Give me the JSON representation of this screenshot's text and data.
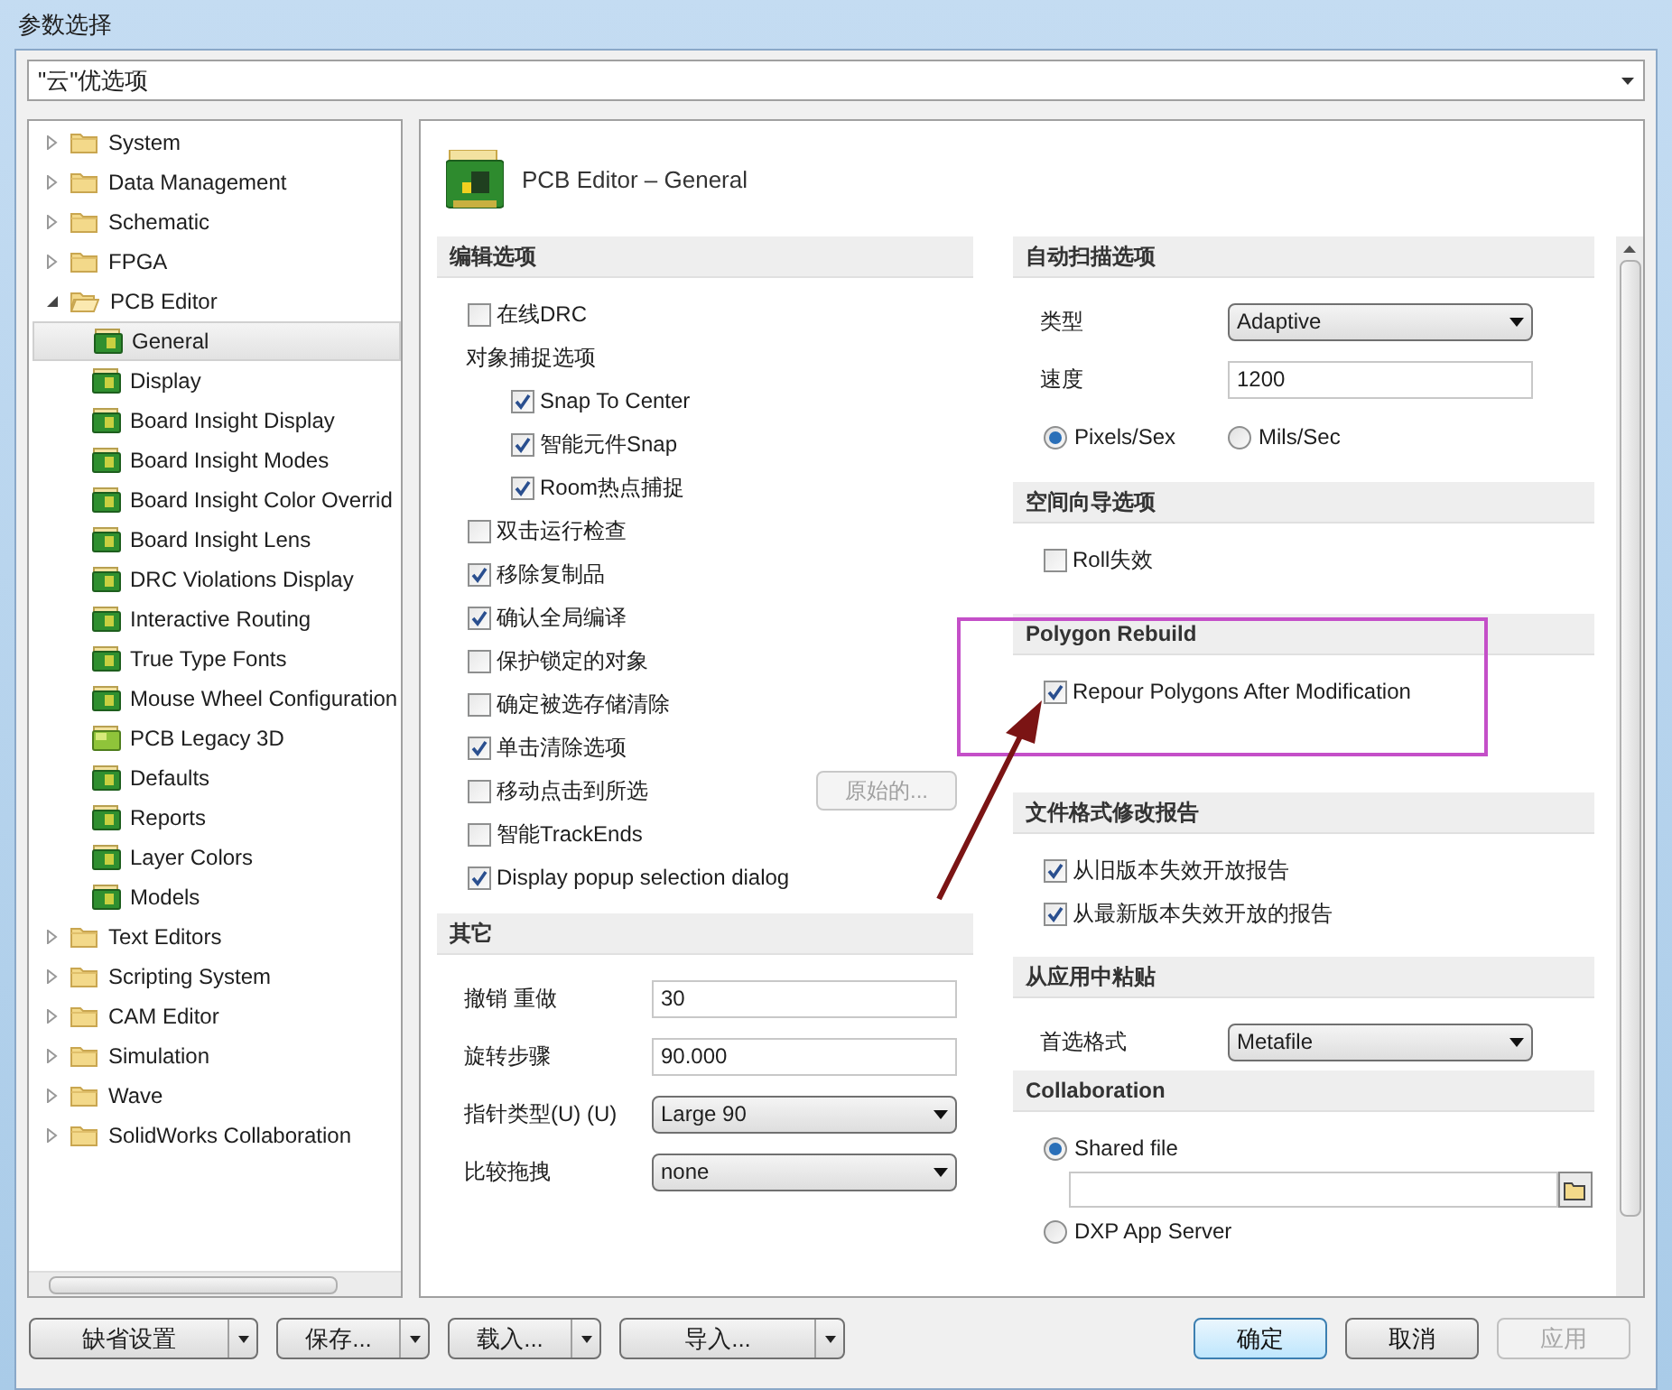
{
  "window": {
    "title": "参数选择"
  },
  "preset_combo": {
    "value": "\"云\"优选项"
  },
  "tree": [
    {
      "kind": "folder",
      "label": "System",
      "expanded": false
    },
    {
      "kind": "folder",
      "label": "Data Management",
      "expanded": false
    },
    {
      "kind": "folder",
      "label": "Schematic",
      "expanded": false
    },
    {
      "kind": "folder",
      "label": "FPGA",
      "expanded": false
    },
    {
      "kind": "folder",
      "label": "PCB Editor",
      "expanded": true,
      "children": [
        {
          "kind": "page",
          "label": "General",
          "selected": true
        },
        {
          "kind": "page",
          "label": "Display",
          "selected": false
        },
        {
          "kind": "page",
          "label": "Board Insight Display",
          "selected": false
        },
        {
          "kind": "page",
          "label": "Board Insight Modes",
          "selected": false
        },
        {
          "kind": "page",
          "label": "Board Insight Color Overrid",
          "selected": false
        },
        {
          "kind": "page",
          "label": "Board Insight Lens",
          "selected": false
        },
        {
          "kind": "page",
          "label": "DRC Violations Display",
          "selected": false
        },
        {
          "kind": "page",
          "label": "Interactive Routing",
          "selected": false
        },
        {
          "kind": "page",
          "label": "True Type Fonts",
          "selected": false
        },
        {
          "kind": "page",
          "label": "Mouse Wheel Configuration",
          "selected": false
        },
        {
          "kind": "page3d",
          "label": "PCB Legacy 3D",
          "selected": false
        },
        {
          "kind": "page",
          "label": "Defaults",
          "selected": false
        },
        {
          "kind": "page",
          "label": "Reports",
          "selected": false
        },
        {
          "kind": "page",
          "label": "Layer Colors",
          "selected": false
        },
        {
          "kind": "page",
          "label": "Models",
          "selected": false
        }
      ]
    },
    {
      "kind": "folder",
      "label": "Text Editors",
      "expanded": false
    },
    {
      "kind": "folder",
      "label": "Scripting System",
      "expanded": false
    },
    {
      "kind": "folder",
      "label": "CAM Editor",
      "expanded": false
    },
    {
      "kind": "folder",
      "label": "Simulation",
      "expanded": false
    },
    {
      "kind": "folder",
      "label": "Wave",
      "expanded": false
    },
    {
      "kind": "folder",
      "label": "SolidWorks Collaboration",
      "expanded": false
    }
  ],
  "page_title": "PCB Editor – General",
  "left_column": [
    {
      "heading": "编辑选项",
      "items": [
        {
          "kind": "checkbox",
          "label": "在线DRC",
          "checked": false
        },
        {
          "kind": "group",
          "label": "对象捕捉选项",
          "children": [
            {
              "kind": "checkbox",
              "label": "Snap To Center",
              "checked": true
            },
            {
              "kind": "checkbox",
              "label": "智能元件Snap",
              "checked": true
            },
            {
              "kind": "checkbox",
              "label": "Room热点捕捉",
              "checked": true
            }
          ]
        },
        {
          "kind": "checkbox",
          "label": "双击运行检查",
          "checked": false
        },
        {
          "kind": "checkbox",
          "label": "移除复制品",
          "checked": true
        },
        {
          "kind": "checkbox",
          "label": "确认全局编译",
          "checked": true
        },
        {
          "kind": "checkbox",
          "label": "保护锁定的对象",
          "checked": false
        },
        {
          "kind": "checkbox",
          "label": "确定被选存储清除",
          "checked": false
        },
        {
          "kind": "checkbox",
          "label": "单击清除选项",
          "checked": true
        },
        {
          "kind": "checkbox",
          "label": "移动点击到所选",
          "checked": false,
          "button": {
            "label": "原始的...",
            "disabled": true
          }
        },
        {
          "kind": "checkbox",
          "label": "智能TrackEnds",
          "checked": false
        },
        {
          "kind": "checkbox",
          "label": "Display popup selection dialog",
          "checked": true
        }
      ]
    },
    {
      "heading": "其它",
      "items": [
        {
          "kind": "text",
          "label": "撤销 重做",
          "value": "30"
        },
        {
          "kind": "text",
          "label": "旋转步骤",
          "value": "90.000"
        },
        {
          "kind": "select",
          "label": "指针类型(U) (U)",
          "value": "Large 90"
        },
        {
          "kind": "select",
          "label": "比较拖拽",
          "value": "none"
        }
      ]
    }
  ],
  "right_column": [
    {
      "heading": "自动扫描选项",
      "items": [
        {
          "kind": "select",
          "label": "类型",
          "value": "Adaptive"
        },
        {
          "kind": "text",
          "label": "速度",
          "value": "1200"
        },
        {
          "kind": "radios",
          "options": [
            {
              "label": "Pixels/Sex",
              "selected": true
            },
            {
              "label": "Mils/Sec",
              "selected": false
            }
          ]
        }
      ]
    },
    {
      "heading": "空间向导选项",
      "items": [
        {
          "kind": "checkbox",
          "label": "Roll失效",
          "checked": false
        }
      ]
    },
    {
      "heading": "Polygon Rebuild",
      "items": [
        {
          "kind": "checkbox",
          "label": "Repour Polygons After Modification",
          "checked": true
        }
      ]
    },
    {
      "heading": "文件格式修改报告",
      "items": [
        {
          "kind": "checkbox",
          "label": "从旧版本失效开放报告",
          "checked": true
        },
        {
          "kind": "checkbox",
          "label": "从最新版本失效开放的报告",
          "checked": true
        }
      ]
    },
    {
      "heading": "从应用中粘贴",
      "items": [
        {
          "kind": "select",
          "label": "首选格式",
          "value": "Metafile"
        }
      ]
    },
    {
      "heading": "Collaboration",
      "items": [
        {
          "kind": "radio",
          "label": "Shared file",
          "selected": true
        },
        {
          "kind": "file"
        },
        {
          "kind": "radio",
          "label": "DXP App Server",
          "selected": false
        }
      ]
    }
  ],
  "left_buttons": [
    {
      "label": "缺省设置"
    },
    {
      "label": "保存..."
    },
    {
      "label": "载入..."
    },
    {
      "label": "导入..."
    }
  ],
  "right_buttons": [
    {
      "label": "确定",
      "default": true,
      "disabled": false
    },
    {
      "label": "取消",
      "default": false,
      "disabled": false
    },
    {
      "label": "应用",
      "default": false,
      "disabled": true
    }
  ]
}
